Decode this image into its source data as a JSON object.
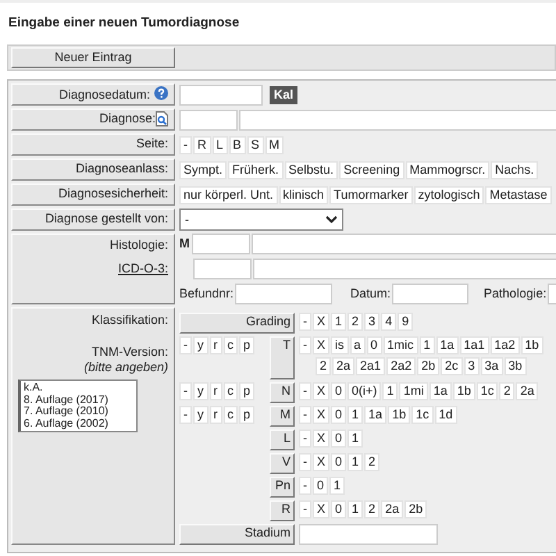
{
  "title": "Eingabe einer neuen Tumordiagnose",
  "toolbar": {
    "button": "Neuer Eintrag"
  },
  "diagnosedatum": {
    "label": "Diagnosedatum:",
    "button": "Kal"
  },
  "diagnose": {
    "label": "Diagnose:"
  },
  "seite": {
    "label": "Seite:",
    "options": [
      {
        "label": "-",
        "selected": false
      },
      {
        "label": "R",
        "selected": false
      },
      {
        "label": "L",
        "selected": false
      },
      {
        "label": "B",
        "selected": false
      },
      {
        "label": "S",
        "selected": false
      },
      {
        "label": "M",
        "selected": false
      }
    ]
  },
  "diagnoseanlass": {
    "label": "Diagnoseanlass:",
    "options": [
      {
        "label": "Sympt.",
        "selected": false
      },
      {
        "label": "Früherk.",
        "selected": false
      },
      {
        "label": "Selbstu.",
        "selected": false
      },
      {
        "label": "Screening",
        "selected": false
      },
      {
        "label": "Mammogrscr.",
        "selected": false
      },
      {
        "label": "Nachs.",
        "selected": false
      }
    ]
  },
  "diagnosesicherheit": {
    "label": "Diagnosesicherheit:",
    "options": [
      {
        "label": "nur körperl. Unt.",
        "selected": false
      },
      {
        "label": "klinisch",
        "selected": false
      },
      {
        "label": "Tumormarker",
        "selected": false
      },
      {
        "label": "zytologisch",
        "selected": false
      },
      {
        "label": "Metastase",
        "selected": false
      }
    ]
  },
  "gestellt_von": {
    "label": "Diagnose gestellt von:",
    "value": "-"
  },
  "histologie": {
    "label": "Histologie:",
    "prefix": "M",
    "icd_link": "ICD-O-3:",
    "befundnr_label": "Befundnr:",
    "datum_label": "Datum:",
    "pathologie_label": "Pathologie:"
  },
  "klassifikation": {
    "label": "Klassifikation:",
    "tnm_label": "TNM-Version:",
    "tnm_hint": "(bitte angeben)",
    "tnm_versions": [
      {
        "label": "k.A.",
        "selected": false
      },
      {
        "label": "8. Auflage (2017)",
        "selected": false
      },
      {
        "label": "7. Auflage (2010)",
        "selected": false
      },
      {
        "label": "6. Auflage (2002)",
        "selected": false
      }
    ],
    "grading": {
      "label": "Grading",
      "options": [
        {
          "label": "-",
          "selected": false
        },
        {
          "label": "X",
          "selected": false
        },
        {
          "label": "1",
          "selected": false
        },
        {
          "label": "2",
          "selected": false
        },
        {
          "label": "3",
          "selected": false
        },
        {
          "label": "4",
          "selected": false
        },
        {
          "label": "9",
          "selected": false
        }
      ]
    },
    "tnm_rows": [
      {
        "label": "T",
        "prefixes": [
          {
            "label": "-",
            "selected": false
          },
          {
            "label": "y",
            "selected": false
          },
          {
            "label": "r",
            "selected": false
          },
          {
            "label": "c",
            "selected": false
          },
          {
            "label": "p",
            "selected": false
          }
        ],
        "option_lines": [
          [
            {
              "label": "-",
              "selected": false
            },
            {
              "label": "X",
              "selected": false
            },
            {
              "label": "is",
              "selected": false
            },
            {
              "label": "a",
              "selected": false
            },
            {
              "label": "0",
              "selected": false
            },
            {
              "label": "1mic",
              "selected": false
            },
            {
              "label": "1",
              "selected": false
            },
            {
              "label": "1a",
              "selected": false
            },
            {
              "label": "1a1",
              "selected": false
            },
            {
              "label": "1a2",
              "selected": false
            },
            {
              "label": "1b",
              "selected": false
            }
          ],
          [
            {
              "label": "2",
              "selected": false
            },
            {
              "label": "2a",
              "selected": false
            },
            {
              "label": "2a1",
              "selected": false
            },
            {
              "label": "2a2",
              "selected": false
            },
            {
              "label": "2b",
              "selected": false
            },
            {
              "label": "2c",
              "selected": false
            },
            {
              "label": "3",
              "selected": false
            },
            {
              "label": "3a",
              "selected": false
            },
            {
              "label": "3b",
              "selected": false
            }
          ]
        ]
      },
      {
        "label": "N",
        "prefixes": [
          {
            "label": "-",
            "selected": false
          },
          {
            "label": "y",
            "selected": false
          },
          {
            "label": "r",
            "selected": false
          },
          {
            "label": "c",
            "selected": false
          },
          {
            "label": "p",
            "selected": false
          }
        ],
        "options": [
          {
            "label": "-",
            "selected": false
          },
          {
            "label": "X",
            "selected": false
          },
          {
            "label": "0",
            "selected": false
          },
          {
            "label": "0(i+)",
            "selected": false
          },
          {
            "label": "1",
            "selected": false
          },
          {
            "label": "1mi",
            "selected": false
          },
          {
            "label": "1a",
            "selected": false
          },
          {
            "label": "1b",
            "selected": false
          },
          {
            "label": "1c",
            "selected": false
          },
          {
            "label": "2",
            "selected": false
          },
          {
            "label": "2a",
            "selected": false
          }
        ]
      },
      {
        "label": "M",
        "prefixes": [
          {
            "label": "-",
            "selected": false
          },
          {
            "label": "y",
            "selected": false
          },
          {
            "label": "r",
            "selected": false
          },
          {
            "label": "c",
            "selected": false
          },
          {
            "label": "p",
            "selected": false
          }
        ],
        "options": [
          {
            "label": "-",
            "selected": false
          },
          {
            "label": "X",
            "selected": false
          },
          {
            "label": "0",
            "selected": false
          },
          {
            "label": "1",
            "selected": false
          },
          {
            "label": "1a",
            "selected": false
          },
          {
            "label": "1b",
            "selected": false
          },
          {
            "label": "1c",
            "selected": false
          },
          {
            "label": "1d",
            "selected": false
          }
        ]
      },
      {
        "label": "L",
        "options": [
          {
            "label": "-",
            "selected": false
          },
          {
            "label": "X",
            "selected": false
          },
          {
            "label": "0",
            "selected": false
          },
          {
            "label": "1",
            "selected": false
          }
        ]
      },
      {
        "label": "V",
        "options": [
          {
            "label": "-",
            "selected": false
          },
          {
            "label": "X",
            "selected": false
          },
          {
            "label": "0",
            "selected": false
          },
          {
            "label": "1",
            "selected": false
          },
          {
            "label": "2",
            "selected": false
          }
        ]
      },
      {
        "label": "Pn",
        "options": [
          {
            "label": "-",
            "selected": false
          },
          {
            "label": "0",
            "selected": false
          },
          {
            "label": "1",
            "selected": false
          }
        ]
      },
      {
        "label": "R",
        "options": [
          {
            "label": "-",
            "selected": false
          },
          {
            "label": "X",
            "selected": false
          },
          {
            "label": "0",
            "selected": false
          },
          {
            "label": "1",
            "selected": false
          },
          {
            "label": "2",
            "selected": false
          },
          {
            "label": "2a",
            "selected": false
          },
          {
            "label": "2b",
            "selected": false
          }
        ]
      }
    ],
    "stadium_label": "Stadium"
  }
}
